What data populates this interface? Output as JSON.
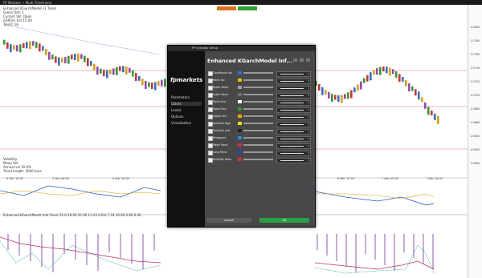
{
  "window": {
    "title_left": "FP Markets ~ Multi Timeframe"
  },
  "overlay": {
    "info_lines": [
      "Enhanced KGarchModel v1 Trend",
      "Green Dot: 1",
      "Current Vol: Open",
      "GARCH: Est 15.00",
      "Trend: Up"
    ],
    "lower_info": [
      "Volatility",
      "Mean Vol",
      "Annual vol 20.0%",
      "Trend length: 3000 bars"
    ],
    "sub_label": "Enhanced KGarchModel Info  Trend 15.0 20.00  25.00  11.03  0.0%  7.24  10.00  0.00  0.00"
  },
  "axis": {
    "ticks": [
      "1.0800",
      "1.0780",
      "1.0760",
      "1.0740",
      "1.0720",
      "1.0700",
      "1.0680",
      "1.0660",
      "1.0640",
      "1.0620",
      "1.0600"
    ]
  },
  "xaxis": {
    "ticks": [
      "4 Mar 18:00",
      "5 Mar 06:00",
      "5 Mar 18:00",
      "6 Mar 06:00",
      "6 Mar 18:00",
      "7 Mar 06:00",
      "7 Mar 18:00"
    ]
  },
  "dialog": {
    "window_title": "FP Indicator Setup",
    "heading": "Enhanced KGarchModel Inf...",
    "logo": "fpmarkets",
    "side_items": [
      "Parameters",
      "Colors",
      "Levels",
      "Options",
      "Visualization"
    ],
    "rows": [
      {
        "label": "Conditional Vol",
        "color": "#2f6fd6"
      },
      {
        "label": "Mean Vol",
        "color": "#e0c000"
      },
      {
        "label": "Upper Band",
        "color": "#a0a0a0"
      },
      {
        "label": "Lower Band",
        "color": "#707070"
      },
      {
        "label": "Trend Line",
        "color": "#ffffff"
      },
      {
        "label": "Signal Buy",
        "color": "#2aa02a"
      },
      {
        "label": "Signal Sell",
        "color": "#ffa500"
      },
      {
        "label": "Volatility High",
        "color": "#f0e000"
      },
      {
        "label": "Volatility Low",
        "color": "#222222"
      },
      {
        "label": "Histogram",
        "color": "#1e8fd6"
      },
      {
        "label": "Mean Trend",
        "color": "#c03060"
      },
      {
        "label": "Long Trend",
        "color": "#2b3ec0"
      },
      {
        "label": "Volatility Ratio",
        "color": "#d83030"
      }
    ],
    "cancel": "Cancel",
    "ok": "OK"
  }
}
